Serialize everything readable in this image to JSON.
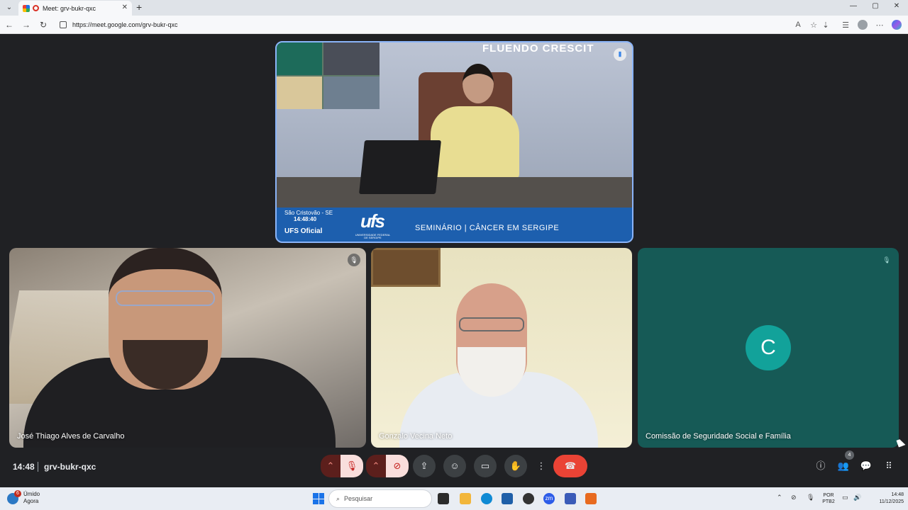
{
  "browser": {
    "tab_title": "Meet: grv-bukr-qxc",
    "tab_close": "✕",
    "new_tab": "+",
    "url": "https://meet.google.com/grv-bukr-qxc",
    "window_controls": [
      "—",
      "▢",
      "✕"
    ]
  },
  "presentation": {
    "motto": "FLUENDO CRESCIT",
    "location": "São Cristovão - SE",
    "time": "14:48:40",
    "channel": "UFS Oficial",
    "logo": "ufs",
    "logo_sub": "UNIVERSIDADE FEDERAL DE SERGIPE",
    "seminar": "SEMINÁRIO |  CÂNCER  EM  SERGIPE"
  },
  "participants": [
    {
      "name": "José Thiago Alves de Carvalho",
      "muted": true
    },
    {
      "name": "Gonzalo Vecina Neto",
      "muted": false
    },
    {
      "name": "Comissão de Seguridade Social e Família",
      "initial": "C",
      "muted": true
    }
  ],
  "meeting": {
    "time": "14:48",
    "code": "grv-bukr-qxc",
    "participant_count": "4"
  },
  "taskbar": {
    "weather_label": "Úmido",
    "weather_sub": "Agora",
    "weather_badge": "6",
    "search_placeholder": "Pesquisar",
    "lang_1": "POR",
    "lang_2": "PTB2",
    "clock_time": "14:48",
    "clock_date": "11/12/2025"
  },
  "colors": {
    "meet_bg": "#202124",
    "end_call": "#ea4335",
    "tile_teal": "#165a56",
    "avatar": "#12a29a",
    "banner": "#1d5fae"
  }
}
